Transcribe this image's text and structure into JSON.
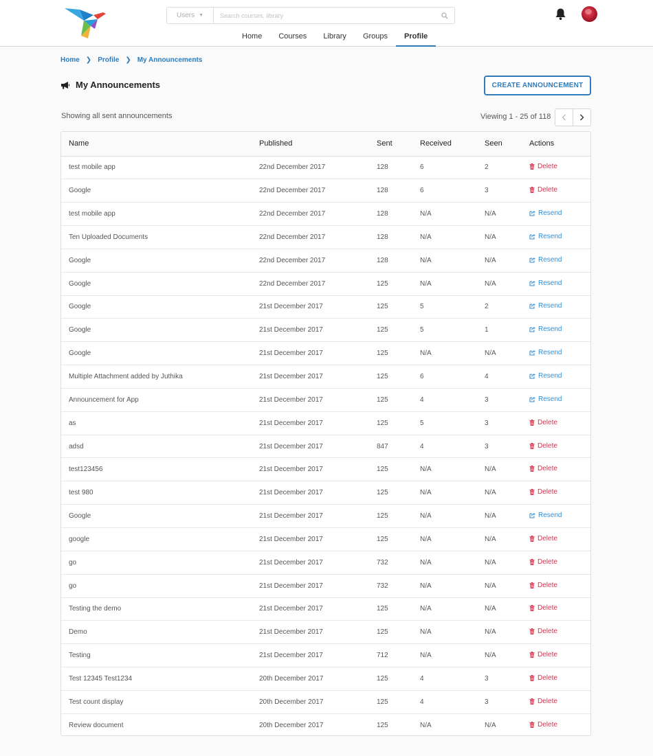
{
  "header": {
    "search": {
      "scope": "Users",
      "placeholder": "Search courses, library"
    },
    "nav": [
      {
        "label": "Home"
      },
      {
        "label": "Courses"
      },
      {
        "label": "Library"
      },
      {
        "label": "Groups"
      },
      {
        "label": "Profile",
        "active": true
      }
    ]
  },
  "breadcrumb": [
    "Home",
    "Profile",
    "My Announcements"
  ],
  "page": {
    "title": "My Announcements",
    "create_label": "CREATE ANNOUNCEMENT",
    "showing": "Showing all sent announcements",
    "viewing": "Viewing 1 - 25 of 118"
  },
  "table": {
    "columns": [
      "Name",
      "Published",
      "Sent",
      "Received",
      "Seen",
      "Actions"
    ],
    "rows": [
      {
        "name": "test mobile app",
        "published": "22nd December 2017",
        "sent": "128",
        "received": "6",
        "seen": "2",
        "action": "Delete"
      },
      {
        "name": "Google",
        "published": "22nd December 2017",
        "sent": "128",
        "received": "6",
        "seen": "3",
        "action": "Delete"
      },
      {
        "name": "test mobile app",
        "published": "22nd December 2017",
        "sent": "128",
        "received": "N/A",
        "seen": "N/A",
        "action": "Resend"
      },
      {
        "name": "Ten Uploaded Documents",
        "published": "22nd December 2017",
        "sent": "128",
        "received": "N/A",
        "seen": "N/A",
        "action": "Resend"
      },
      {
        "name": "Google",
        "published": "22nd December 2017",
        "sent": "128",
        "received": "N/A",
        "seen": "N/A",
        "action": "Resend"
      },
      {
        "name": "Google",
        "published": "22nd December 2017",
        "sent": "125",
        "received": "N/A",
        "seen": "N/A",
        "action": "Resend"
      },
      {
        "name": "Google",
        "published": "21st December 2017",
        "sent": "125",
        "received": "5",
        "seen": "2",
        "action": "Resend"
      },
      {
        "name": "Google",
        "published": "21st December 2017",
        "sent": "125",
        "received": "5",
        "seen": "1",
        "action": "Resend"
      },
      {
        "name": "Google",
        "published": "21st December 2017",
        "sent": "125",
        "received": "N/A",
        "seen": "N/A",
        "action": "Resend"
      },
      {
        "name": "Multiple Attachment added by Juthika",
        "published": "21st December 2017",
        "sent": "125",
        "received": "6",
        "seen": "4",
        "action": "Resend"
      },
      {
        "name": "Announcement for App",
        "published": "21st December 2017",
        "sent": "125",
        "received": "4",
        "seen": "3",
        "action": "Resend"
      },
      {
        "name": "as",
        "published": "21st December 2017",
        "sent": "125",
        "received": "5",
        "seen": "3",
        "action": "Delete"
      },
      {
        "name": "adsd",
        "published": "21st December 2017",
        "sent": "847",
        "received": "4",
        "seen": "3",
        "action": "Delete"
      },
      {
        "name": "test123456",
        "published": "21st December 2017",
        "sent": "125",
        "received": "N/A",
        "seen": "N/A",
        "action": "Delete"
      },
      {
        "name": "test 980",
        "published": "21st December 2017",
        "sent": "125",
        "received": "N/A",
        "seen": "N/A",
        "action": "Delete"
      },
      {
        "name": "Google",
        "published": "21st December 2017",
        "sent": "125",
        "received": "N/A",
        "seen": "N/A",
        "action": "Resend"
      },
      {
        "name": "google",
        "published": "21st December 2017",
        "sent": "125",
        "received": "N/A",
        "seen": "N/A",
        "action": "Delete"
      },
      {
        "name": "go",
        "published": "21st December 2017",
        "sent": "732",
        "received": "N/A",
        "seen": "N/A",
        "action": "Delete"
      },
      {
        "name": "go",
        "published": "21st December 2017",
        "sent": "732",
        "received": "N/A",
        "seen": "N/A",
        "action": "Delete"
      },
      {
        "name": "Testing the demo",
        "published": "21st December 2017",
        "sent": "125",
        "received": "N/A",
        "seen": "N/A",
        "action": "Delete"
      },
      {
        "name": "Demo",
        "published": "21st December 2017",
        "sent": "125",
        "received": "N/A",
        "seen": "N/A",
        "action": "Delete"
      },
      {
        "name": "Testing",
        "published": "21st December 2017",
        "sent": "712",
        "received": "N/A",
        "seen": "N/A",
        "action": "Delete"
      },
      {
        "name": "Test 12345 Test1234",
        "published": "20th December 2017",
        "sent": "125",
        "received": "4",
        "seen": "3",
        "action": "Delete"
      },
      {
        "name": "Test count display",
        "published": "20th December 2017",
        "sent": "125",
        "received": "4",
        "seen": "3",
        "action": "Delete"
      },
      {
        "name": "Review document",
        "published": "20th December 2017",
        "sent": "125",
        "received": "N/A",
        "seen": "N/A",
        "action": "Delete"
      }
    ]
  },
  "colors": {
    "accent": "#2f7ab9",
    "delete": "#d9304a",
    "resend": "#2f8ed6"
  }
}
